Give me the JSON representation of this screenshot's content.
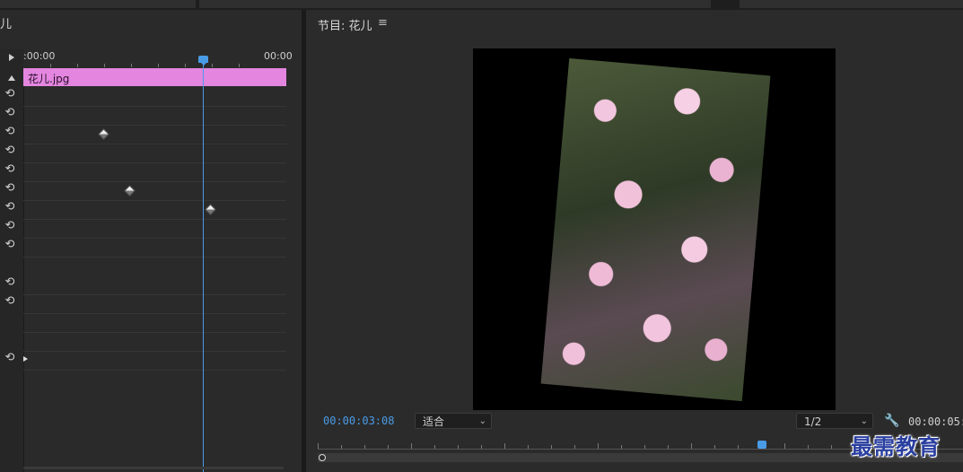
{
  "effect_controls": {
    "panel_title": "儿",
    "ruler_start": ":00:00",
    "ruler_end": "00:00",
    "clip_name": "花儿.jpg"
  },
  "program_monitor": {
    "title": "节目: 花儿",
    "menu_icon": "hamburger-menu-icon",
    "current_time": "00:00:03:08",
    "zoom_fit": "适合",
    "resolution": "1/2",
    "duration": "00:00:05:"
  },
  "icons": {
    "reset": "reset-icon",
    "wrench": "wrench-icon"
  },
  "colors": {
    "accent_blue": "#4a9be6",
    "clip_pink": "#e486e0",
    "panel_bg": "#2a2a2a"
  },
  "watermark": "最需教育"
}
